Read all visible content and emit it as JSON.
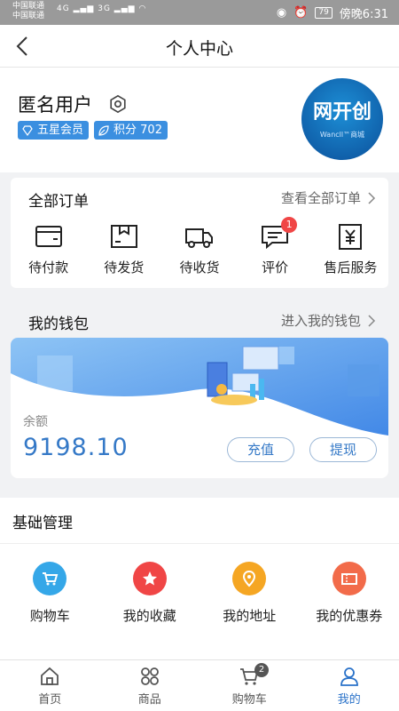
{
  "status_bar": {
    "carrier_1": "中国联通",
    "carrier_2": "中国联通",
    "network_1": "4G",
    "network_2": "3G",
    "battery": "79",
    "time": "傍晚6:31"
  },
  "header": {
    "title": "个人中心"
  },
  "profile": {
    "name": "匿名用户",
    "member_badge": "五星会员",
    "points_badge": "积分 702",
    "avatar_text": "网开创",
    "avatar_subtext": "Wancll™商城"
  },
  "orders": {
    "title": "全部订单",
    "view_all": "查看全部订单",
    "items": [
      {
        "label": "待付款",
        "icon": "wallet-icon"
      },
      {
        "label": "待发货",
        "icon": "package-icon"
      },
      {
        "label": "待收货",
        "icon": "truck-icon"
      },
      {
        "label": "评价",
        "icon": "comment-icon",
        "badge": "1"
      },
      {
        "label": "售后服务",
        "icon": "yen-icon"
      }
    ]
  },
  "wallet": {
    "title": "我的钱包",
    "enter": "进入我的钱包",
    "balance_label": "余额",
    "balance": "9198.10",
    "recharge": "充值",
    "withdraw": "提现"
  },
  "management": {
    "title": "基础管理",
    "items": [
      {
        "label": "购物车",
        "icon": "cart-icon",
        "color": "#35a7e8"
      },
      {
        "label": "我的收藏",
        "icon": "star-icon",
        "color": "#f04646"
      },
      {
        "label": "我的地址",
        "icon": "location-icon",
        "color": "#f5a623"
      },
      {
        "label": "我的优惠券",
        "icon": "coupon-icon",
        "color": "#f26b4a"
      }
    ]
  },
  "tabbar": {
    "items": [
      {
        "label": "首页",
        "icon": "home-icon"
      },
      {
        "label": "商品",
        "icon": "grid-icon"
      },
      {
        "label": "购物车",
        "icon": "cart-icon",
        "badge": "2"
      },
      {
        "label": "我的",
        "icon": "user-icon",
        "active": true
      }
    ]
  },
  "colors": {
    "accent": "#2a72c9",
    "badge_bg": "#3b8fe0",
    "alert": "#f04646"
  }
}
